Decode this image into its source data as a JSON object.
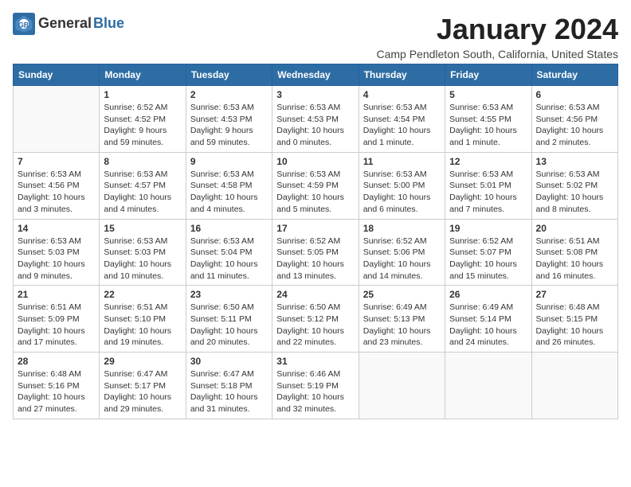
{
  "header": {
    "logo_general": "General",
    "logo_blue": "Blue",
    "month_title": "January 2024",
    "location": "Camp Pendleton South, California, United States"
  },
  "days_of_week": [
    "Sunday",
    "Monday",
    "Tuesday",
    "Wednesday",
    "Thursday",
    "Friday",
    "Saturday"
  ],
  "weeks": [
    [
      {
        "day": "",
        "info": ""
      },
      {
        "day": "1",
        "info": "Sunrise: 6:52 AM\nSunset: 4:52 PM\nDaylight: 9 hours\nand 59 minutes."
      },
      {
        "day": "2",
        "info": "Sunrise: 6:53 AM\nSunset: 4:53 PM\nDaylight: 9 hours\nand 59 minutes."
      },
      {
        "day": "3",
        "info": "Sunrise: 6:53 AM\nSunset: 4:53 PM\nDaylight: 10 hours\nand 0 minutes."
      },
      {
        "day": "4",
        "info": "Sunrise: 6:53 AM\nSunset: 4:54 PM\nDaylight: 10 hours\nand 1 minute."
      },
      {
        "day": "5",
        "info": "Sunrise: 6:53 AM\nSunset: 4:55 PM\nDaylight: 10 hours\nand 1 minute."
      },
      {
        "day": "6",
        "info": "Sunrise: 6:53 AM\nSunset: 4:56 PM\nDaylight: 10 hours\nand 2 minutes."
      }
    ],
    [
      {
        "day": "7",
        "info": "Sunrise: 6:53 AM\nSunset: 4:56 PM\nDaylight: 10 hours\nand 3 minutes."
      },
      {
        "day": "8",
        "info": "Sunrise: 6:53 AM\nSunset: 4:57 PM\nDaylight: 10 hours\nand 4 minutes."
      },
      {
        "day": "9",
        "info": "Sunrise: 6:53 AM\nSunset: 4:58 PM\nDaylight: 10 hours\nand 4 minutes."
      },
      {
        "day": "10",
        "info": "Sunrise: 6:53 AM\nSunset: 4:59 PM\nDaylight: 10 hours\nand 5 minutes."
      },
      {
        "day": "11",
        "info": "Sunrise: 6:53 AM\nSunset: 5:00 PM\nDaylight: 10 hours\nand 6 minutes."
      },
      {
        "day": "12",
        "info": "Sunrise: 6:53 AM\nSunset: 5:01 PM\nDaylight: 10 hours\nand 7 minutes."
      },
      {
        "day": "13",
        "info": "Sunrise: 6:53 AM\nSunset: 5:02 PM\nDaylight: 10 hours\nand 8 minutes."
      }
    ],
    [
      {
        "day": "14",
        "info": "Sunrise: 6:53 AM\nSunset: 5:03 PM\nDaylight: 10 hours\nand 9 minutes."
      },
      {
        "day": "15",
        "info": "Sunrise: 6:53 AM\nSunset: 5:03 PM\nDaylight: 10 hours\nand 10 minutes."
      },
      {
        "day": "16",
        "info": "Sunrise: 6:53 AM\nSunset: 5:04 PM\nDaylight: 10 hours\nand 11 minutes."
      },
      {
        "day": "17",
        "info": "Sunrise: 6:52 AM\nSunset: 5:05 PM\nDaylight: 10 hours\nand 13 minutes."
      },
      {
        "day": "18",
        "info": "Sunrise: 6:52 AM\nSunset: 5:06 PM\nDaylight: 10 hours\nand 14 minutes."
      },
      {
        "day": "19",
        "info": "Sunrise: 6:52 AM\nSunset: 5:07 PM\nDaylight: 10 hours\nand 15 minutes."
      },
      {
        "day": "20",
        "info": "Sunrise: 6:51 AM\nSunset: 5:08 PM\nDaylight: 10 hours\nand 16 minutes."
      }
    ],
    [
      {
        "day": "21",
        "info": "Sunrise: 6:51 AM\nSunset: 5:09 PM\nDaylight: 10 hours\nand 17 minutes."
      },
      {
        "day": "22",
        "info": "Sunrise: 6:51 AM\nSunset: 5:10 PM\nDaylight: 10 hours\nand 19 minutes."
      },
      {
        "day": "23",
        "info": "Sunrise: 6:50 AM\nSunset: 5:11 PM\nDaylight: 10 hours\nand 20 minutes."
      },
      {
        "day": "24",
        "info": "Sunrise: 6:50 AM\nSunset: 5:12 PM\nDaylight: 10 hours\nand 22 minutes."
      },
      {
        "day": "25",
        "info": "Sunrise: 6:49 AM\nSunset: 5:13 PM\nDaylight: 10 hours\nand 23 minutes."
      },
      {
        "day": "26",
        "info": "Sunrise: 6:49 AM\nSunset: 5:14 PM\nDaylight: 10 hours\nand 24 minutes."
      },
      {
        "day": "27",
        "info": "Sunrise: 6:48 AM\nSunset: 5:15 PM\nDaylight: 10 hours\nand 26 minutes."
      }
    ],
    [
      {
        "day": "28",
        "info": "Sunrise: 6:48 AM\nSunset: 5:16 PM\nDaylight: 10 hours\nand 27 minutes."
      },
      {
        "day": "29",
        "info": "Sunrise: 6:47 AM\nSunset: 5:17 PM\nDaylight: 10 hours\nand 29 minutes."
      },
      {
        "day": "30",
        "info": "Sunrise: 6:47 AM\nSunset: 5:18 PM\nDaylight: 10 hours\nand 31 minutes."
      },
      {
        "day": "31",
        "info": "Sunrise: 6:46 AM\nSunset: 5:19 PM\nDaylight: 10 hours\nand 32 minutes."
      },
      {
        "day": "",
        "info": ""
      },
      {
        "day": "",
        "info": ""
      },
      {
        "day": "",
        "info": ""
      }
    ]
  ]
}
